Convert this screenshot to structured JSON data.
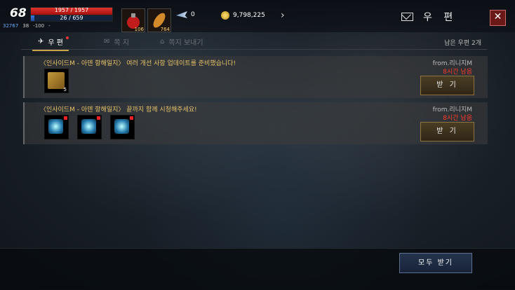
{
  "player": {
    "level": "68",
    "hp": "1957 / 1957",
    "mp": "26 / 659",
    "mp_ratio": 0.04,
    "power": "32767",
    "stat_a": "38",
    "stat_b": "-100",
    "stat_c": "-"
  },
  "items": [
    {
      "count": "106"
    },
    {
      "count": "764"
    }
  ],
  "currency": {
    "feather": "0",
    "adena": "9,798,225"
  },
  "mailbox": {
    "title": "우 편",
    "remaining": "남은 우편 2개"
  },
  "tabs": [
    {
      "label": "우 편"
    },
    {
      "label": "쪽 지"
    },
    {
      "label": "쪽지 보내기"
    }
  ],
  "mails": [
    {
      "subject": "〈인사이드M - 아덴 항해일지〉 여러 개선 사항 업데이트를 준비했습니다!",
      "from": "from.리니지M",
      "time_left": "8시간 남음",
      "receive_label": "받 기",
      "attachments": [
        {
          "icon": "gift-box-icon",
          "count": "5"
        }
      ]
    },
    {
      "subject": "〈인사이드M - 아덴 항해일지〉 끝까지 함께 시청해주세요!",
      "from": "from.리니지M",
      "time_left": "8시간 남음",
      "receive_label": "받 기",
      "attachments": [
        {
          "icon": "blue-gem-icon"
        },
        {
          "icon": "blue-gem-icon"
        },
        {
          "icon": "blue-gem-icon"
        }
      ]
    }
  ],
  "receive_all_label": "모두 받기",
  "colors": {
    "accent_gold": "#c8a24a",
    "time_red": "#ff3b2b",
    "subject_gold": "#e8c36a"
  }
}
